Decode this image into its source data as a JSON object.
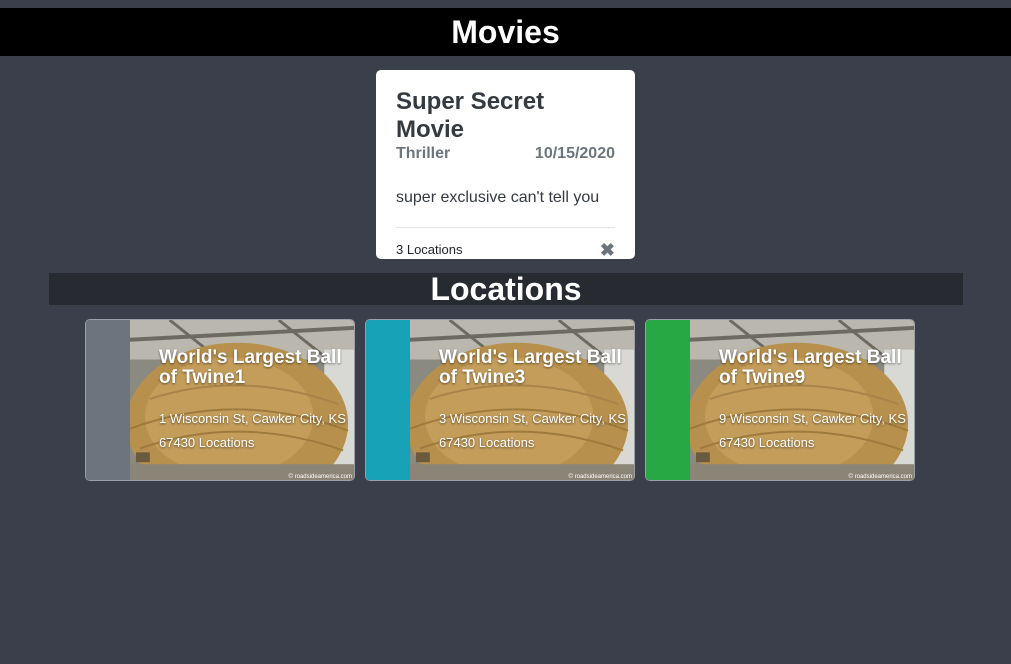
{
  "header": {
    "title": "Movies"
  },
  "movie": {
    "title": "Super Secret Movie",
    "genre": "Thriller",
    "date": "10/15/2020",
    "description": "super exclusive can't tell you",
    "locations_count": "3 Locations",
    "close_icon": "close-icon"
  },
  "locations_section": {
    "title": "Locations"
  },
  "locations": [
    {
      "title": "World's Largest Ball of Twine1",
      "address": "1 Wisconsin St, Cawker City, KS 67430 Locations",
      "accent": "#6c757d",
      "credit": "© roadsideamerica.com"
    },
    {
      "title": "World's Largest Ball of Twine3",
      "address": "3 Wisconsin St, Cawker City, KS 67430 Locations",
      "accent": "#17a2b8",
      "credit": "© roadsideamerica.com"
    },
    {
      "title": "World's Largest Ball of Twine9",
      "address": "9 Wisconsin St, Cawker City, KS 67430 Locations",
      "accent": "#28a745",
      "credit": "© roadsideamerica.com"
    }
  ]
}
